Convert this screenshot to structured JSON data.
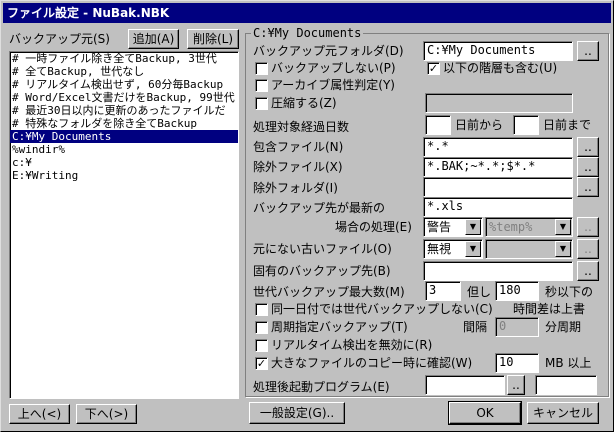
{
  "window": {
    "title": "ファイル設定 - NuBak.NBK"
  },
  "left": {
    "label": "バックアップ元(S)",
    "add_button": "追加(A)",
    "delete_button": "削除(L)",
    "items": [
      "# 一時ファイル除き全てBackup, 3世代",
      "# 全てBackup, 世代なし",
      "# リアルタイム検出せず, 60分毎Backup",
      "# Word/Excel文書だけをBackup, 99世代",
      "# 最近30日以内に更新のあったファイルだ",
      "# 特殊なフォルダを除き全てBackup",
      "C:¥My Documents",
      "%windir%",
      "c:¥",
      "E:¥Writing"
    ],
    "selected_index": 6,
    "up_button": "上へ(<)",
    "down_button": "下へ(>)"
  },
  "group": {
    "title": "C:¥My Documents",
    "dest_folder_label": "バックアップ元フォルダ(D)",
    "dest_folder_value": "C:¥My Documents",
    "browse": "..",
    "no_backup_label": "バックアップしない(P)",
    "no_backup_checked": false,
    "include_sub_label": "以下の階層も含む(U)",
    "include_sub_checked": true,
    "archive_label": "アーカイブ属性判定(Y)",
    "archive_checked": false,
    "compress_label": "圧縮する(Z)",
    "compress_checked": false,
    "days_label": "処理対象経過日数",
    "days_from_label": "日前から",
    "days_to_label": "日前まで",
    "days_from_value": "",
    "days_to_value": "",
    "include_files_label": "包含ファイル(N)",
    "include_files_value": "*.*",
    "exclude_files_label": "除外ファイル(X)",
    "exclude_files_value": "*.BAK;~*.*;$*.*",
    "exclude_folder_label": "除外フォルダ(I)",
    "exclude_folder_value": "",
    "newer_label": "バックアップ先が最新の",
    "newer_value": "*.xls",
    "case_label": "場合の処理(E)",
    "case_select": "警告",
    "case_path": "%temp%",
    "old_files_label": "元にない古いファイル(O)",
    "old_files_select": "無視",
    "old_files_path": "",
    "specific_dest_label": "固有のバックアップ先(B)",
    "specific_dest_value": "",
    "max_gen_label": "世代バックアップ最大数(M)",
    "max_gen_value": "3",
    "but_label": "但し",
    "seconds_value": "180",
    "seconds_label": "秒以下の",
    "same_day_label": "同一日付では世代バックアップしない(C)",
    "same_day_checked": false,
    "time_diff_label": "時間差は上書",
    "periodic_label": "周期指定バックアップ(T)",
    "periodic_checked": false,
    "interval_label": "間隔",
    "interval_value": "0",
    "interval_unit": "分周期",
    "realtime_label": "リアルタイム検出を無効に(R)",
    "realtime_checked": false,
    "large_file_label": "大きなファイルのコピー時に確認(W)",
    "large_file_checked": true,
    "large_file_value": "10",
    "large_file_unit": "MB 以上",
    "post_program_label": "処理後起動プログラム(E)",
    "post_program_value": "",
    "post_program_extra": ""
  },
  "bottom": {
    "general_settings": "一般設定(G)..",
    "ok": "OK",
    "cancel": "キャンセル"
  }
}
